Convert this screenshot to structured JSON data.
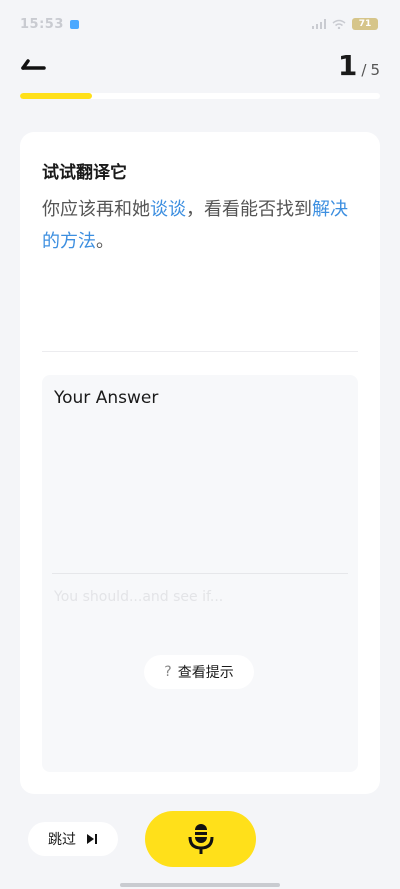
{
  "status_bar": {
    "time": "15:53",
    "battery": "71"
  },
  "header": {
    "current": "1",
    "separator": "/",
    "total": "5",
    "back_icon": "back-arrow-icon"
  },
  "progress": {
    "current": 1,
    "total": 5,
    "fraction": 0.2,
    "fill_color": "#ffe01a"
  },
  "card": {
    "title": "试试翻译它",
    "sentence_parts": {
      "p1": "你应该再和她",
      "h1": "谈谈",
      "p2": "，看看能否找到",
      "h2": "解决的方法",
      "p3": "。"
    },
    "highlight_color": "#3d8fe0"
  },
  "answer": {
    "label": "Your Answer",
    "placeholder": "You should...and see if...",
    "hint_icon_char": "?",
    "hint_label": "查看提示"
  },
  "footer": {
    "skip_label": "跳过",
    "skip_icon": "skip-next-icon",
    "mic_icon": "microphone-icon",
    "accent_color": "#ffe01a"
  }
}
